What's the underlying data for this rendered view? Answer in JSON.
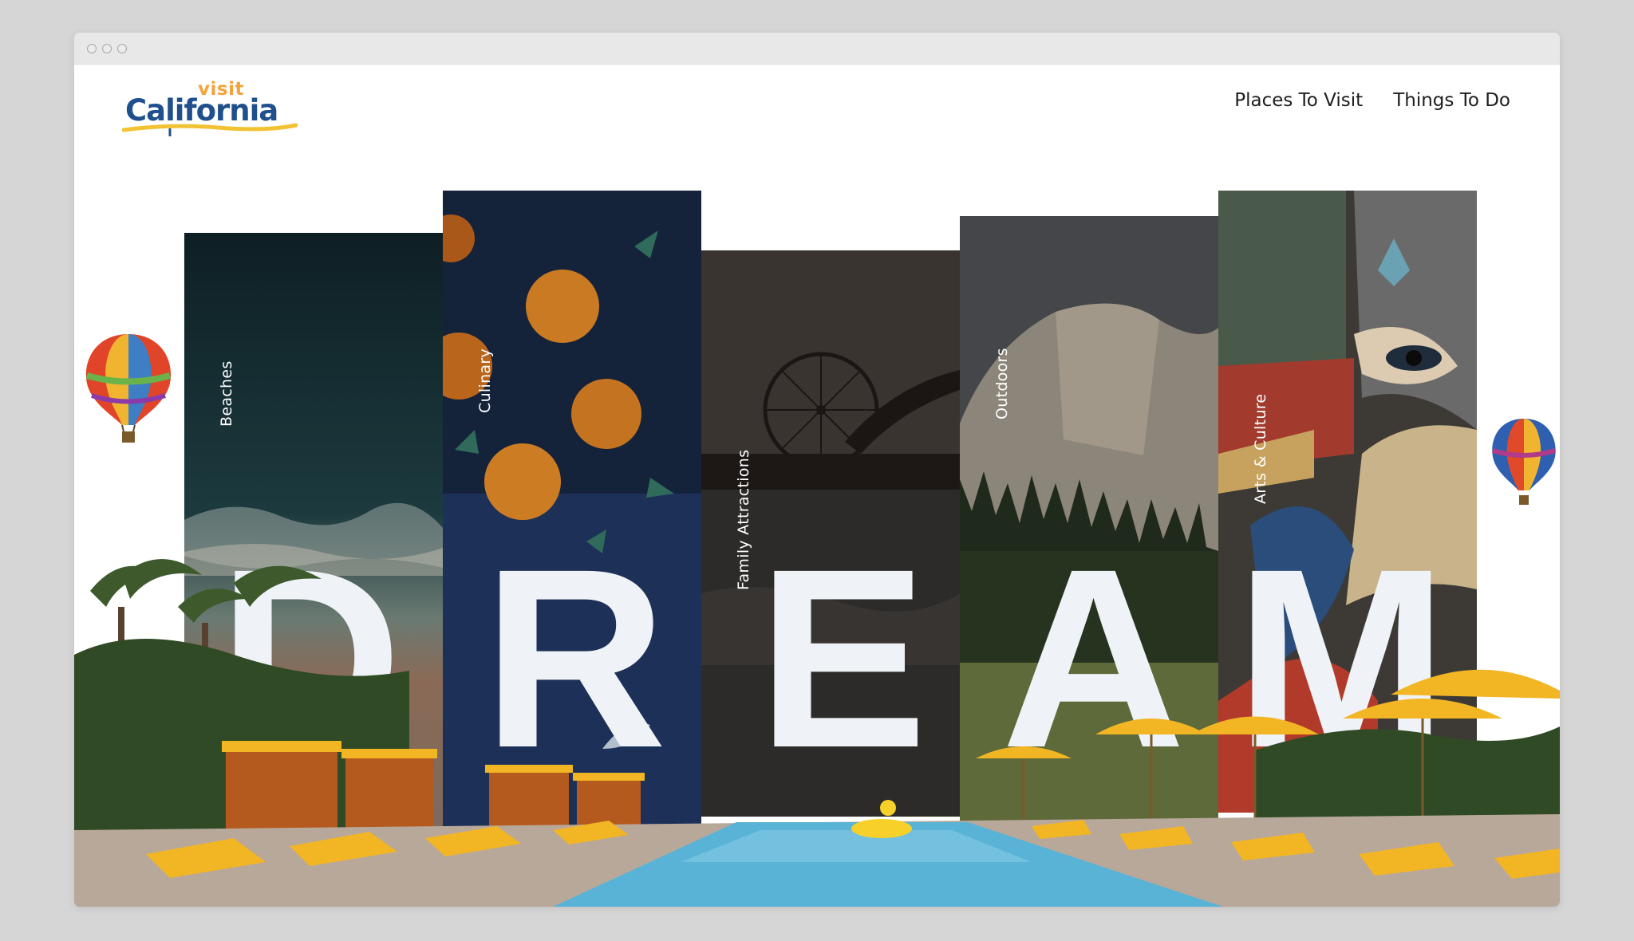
{
  "logo": {
    "top_word": "visit",
    "main_word": "California",
    "colors": {
      "top": "#f2a33a",
      "main": "#1f4f8c",
      "swoosh": "#f3c233"
    }
  },
  "nav": {
    "items": [
      {
        "label": "Places To Visit"
      },
      {
        "label": "Things To Do"
      }
    ]
  },
  "categories": [
    {
      "label": "Beaches"
    },
    {
      "label": "Culinary"
    },
    {
      "label": "Family Attractions"
    },
    {
      "label": "Outdoors"
    },
    {
      "label": "Arts & Culture"
    }
  ],
  "hero": {
    "letters": [
      "D",
      "R",
      "E",
      "A",
      "M"
    ],
    "letter_color": "#eff2f6"
  },
  "icons": [
    "hot-air-balloon-icon",
    "window-dot-icon"
  ],
  "colors": {
    "accent_yellow": "#f2b524",
    "pool_blue": "#58b3d6",
    "page_bg": "#d6d6d6"
  }
}
